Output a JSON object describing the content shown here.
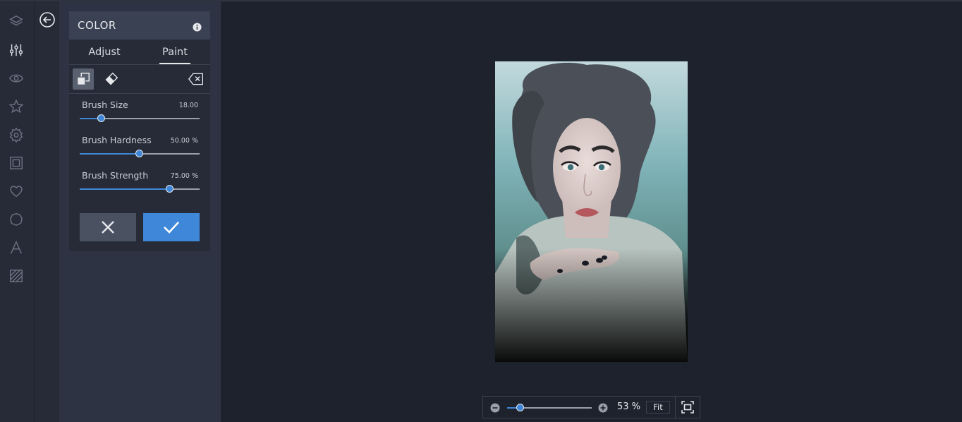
{
  "rail": {
    "icons": [
      "layers-icon",
      "adjust-sliders-icon",
      "eye-icon",
      "star-icon",
      "badge-icon",
      "frame-icon",
      "heart-icon",
      "shape-icon",
      "text-icon",
      "texture-icon"
    ],
    "active": "adjust-sliders-icon"
  },
  "panel": {
    "title": "COLOR",
    "tabs": [
      {
        "label": "Adjust",
        "active": false
      },
      {
        "label": "Paint",
        "active": true
      }
    ],
    "tools": [
      "brush-tool-icon",
      "eraser-icon",
      "clear-icon"
    ],
    "sliders": [
      {
        "label": "Brush Size",
        "value": "18.00",
        "position": 0.18
      },
      {
        "label": "Brush Hardness",
        "value": "50.00 %",
        "position": 0.5
      },
      {
        "label": "Brush Strength",
        "value": "75.00 %",
        "position": 0.75
      }
    ]
  },
  "zoom": {
    "value": "53 %",
    "fit_label": "Fit",
    "position": 0.15
  },
  "colors": {
    "accent": "#3f87d8",
    "panel_header": "#3a4152",
    "background": "#1e222c"
  }
}
